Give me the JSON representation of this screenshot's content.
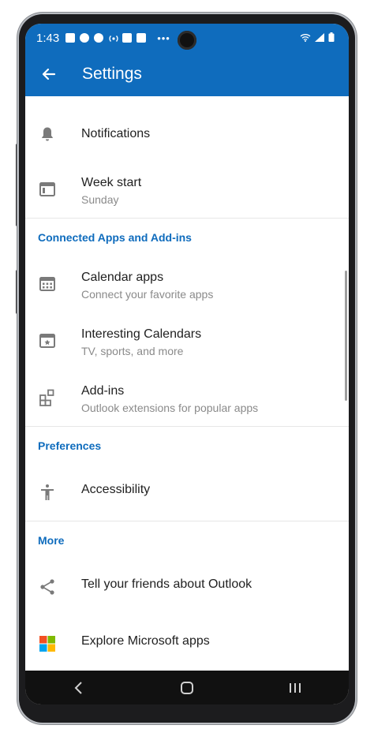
{
  "status_bar": {
    "time": "1:43",
    "dots": "•••"
  },
  "app_bar": {
    "title": "Settings"
  },
  "items": {
    "notifications": {
      "title": "Notifications"
    },
    "week_start": {
      "title": "Week start",
      "subtitle": "Sunday"
    },
    "calendar_apps": {
      "title": "Calendar apps",
      "subtitle": "Connect your favorite apps"
    },
    "interesting_calendars": {
      "title": "Interesting Calendars",
      "subtitle": "TV, sports, and more"
    },
    "add_ins": {
      "title": "Add-ins",
      "subtitle": "Outlook extensions for popular apps"
    },
    "accessibility": {
      "title": "Accessibility"
    },
    "tell_friends": {
      "title": "Tell your friends about Outlook"
    },
    "explore_apps": {
      "title": "Explore Microsoft apps"
    }
  },
  "sections": {
    "connected": "Connected Apps and Add-ins",
    "preferences": "Preferences",
    "more": "More"
  },
  "colors": {
    "accent": "#0f6cbd",
    "icon_gray": "#7a7a7a"
  }
}
